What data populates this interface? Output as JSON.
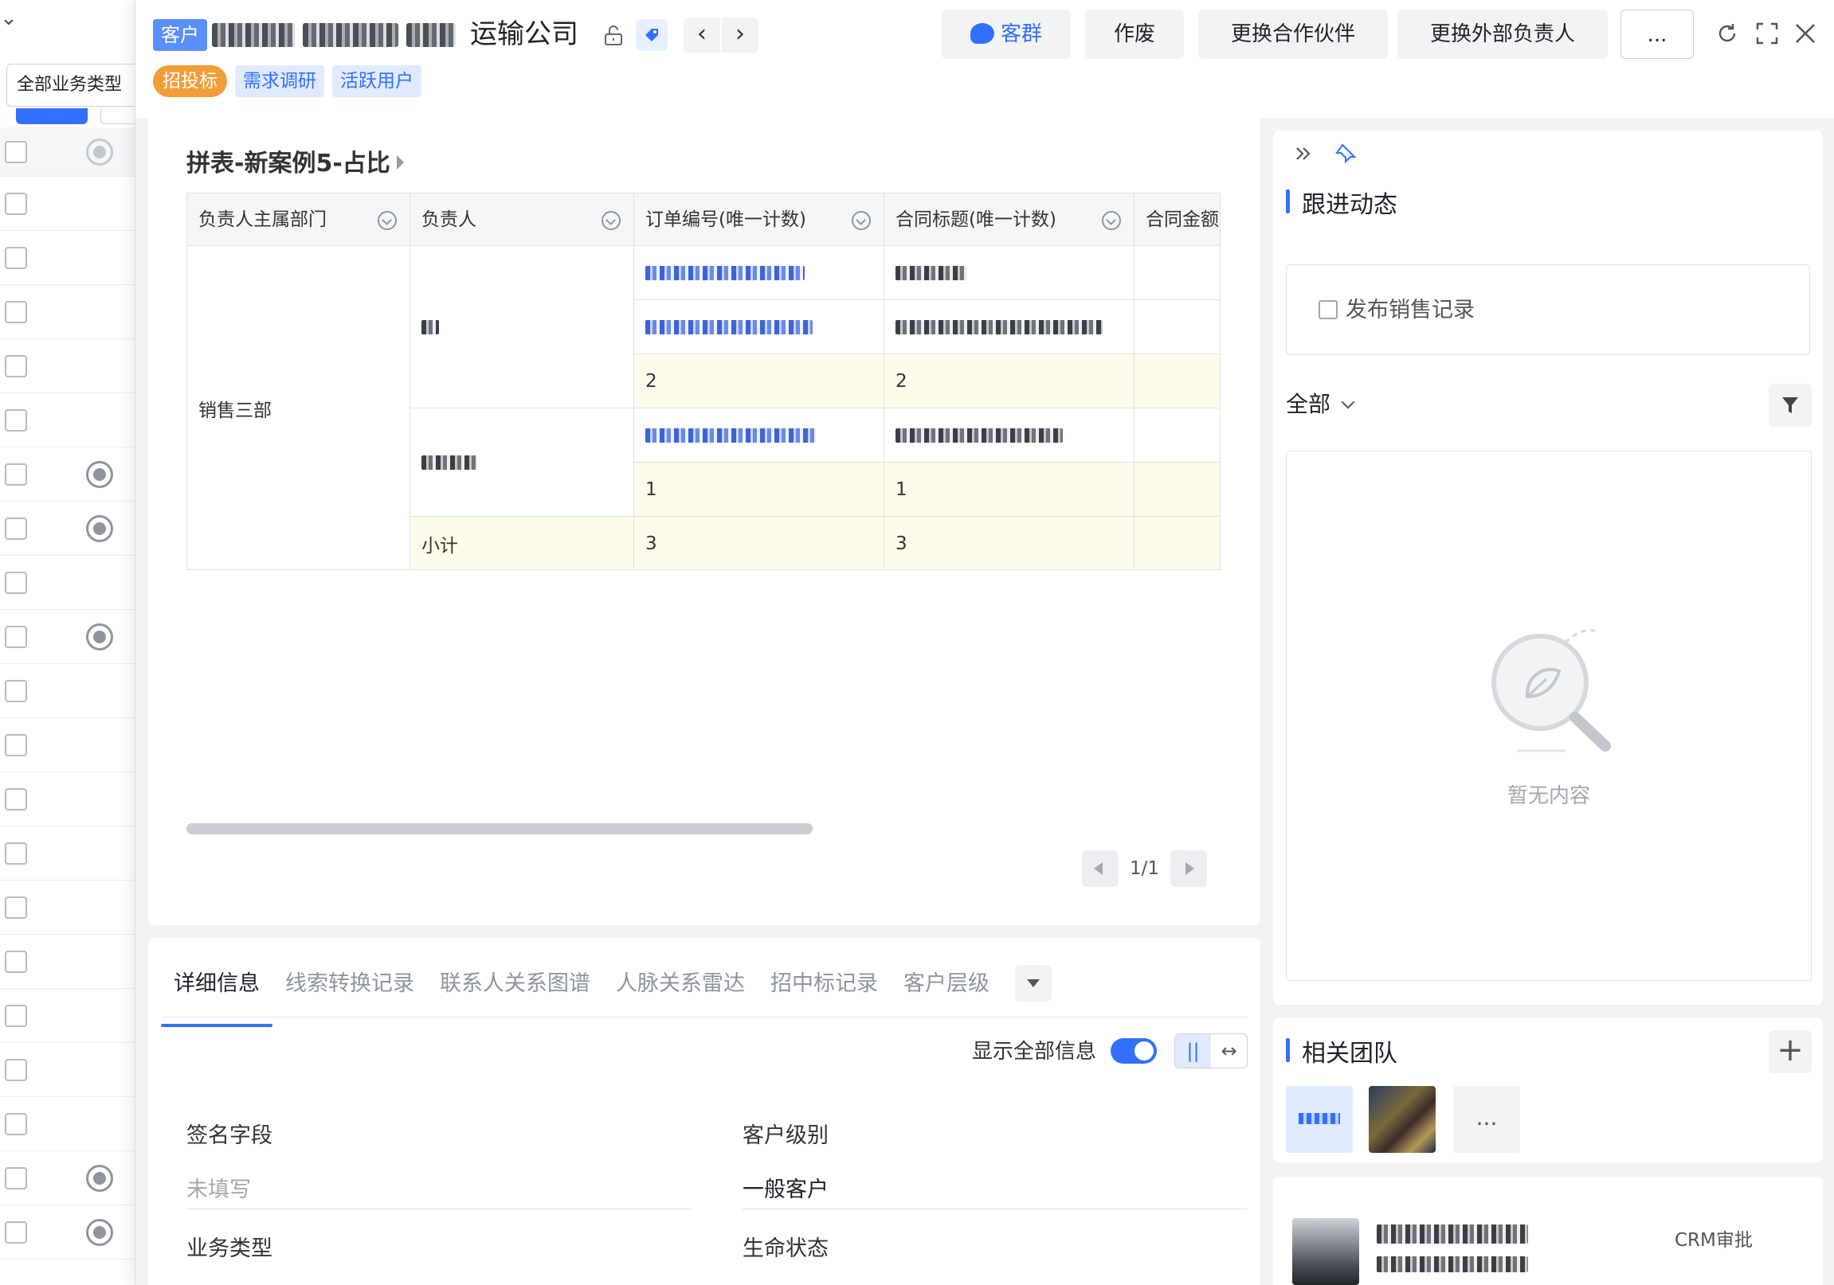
{
  "left_list": {
    "business_type_select": "全部业务类型",
    "rows_count": 20
  },
  "header": {
    "badge": "客户",
    "title_visible_suffix": "运输公司",
    "tags": [
      "招投标",
      "需求调研",
      "活跃用户"
    ],
    "buttons": {
      "group_chat": "客群",
      "void": "作废",
      "change_partner": "更换合作伙伴",
      "change_external_owner": "更换外部负责人",
      "more": "..."
    }
  },
  "main": {
    "card_title": "拼表-新案例5-占比",
    "table": {
      "columns": [
        "负责人主属部门",
        "负责人",
        "订单编号(唯一计数)",
        "合同标题(唯一计数)",
        "合同金额"
      ],
      "department": "销售三部",
      "owner1_subtotal": {
        "order": "2",
        "contract": "2"
      },
      "owner2_subtotal": {
        "order": "1",
        "contract": "1"
      },
      "subtotal_label": "小计",
      "total": {
        "order": "3",
        "contract": "3"
      }
    },
    "pager": "1/1"
  },
  "detail": {
    "tabs": [
      "详细信息",
      "线索转换记录",
      "联系人关系图谱",
      "人脉关系雷达",
      "招中标记录",
      "客户层级"
    ],
    "show_all_label": "显示全部信息",
    "fields": {
      "signature_label": "签名字段",
      "signature_value": "未填写",
      "customer_level_label": "客户级别",
      "customer_level_value": "一般客户",
      "business_type_label": "业务类型",
      "lifecycle_label": "生命状态"
    }
  },
  "right": {
    "follow_title": "跟进动态",
    "publish_label": "发布销售记录",
    "filter_all": "全部",
    "empty_text": "暂无内容",
    "team_title": "相关团队",
    "team_more": "...",
    "approval_label": "CRM审批"
  },
  "colors": {
    "accent": "#3370ff",
    "tag_orange": "#f29d38",
    "subtotal_bg": "#fffbeb"
  }
}
